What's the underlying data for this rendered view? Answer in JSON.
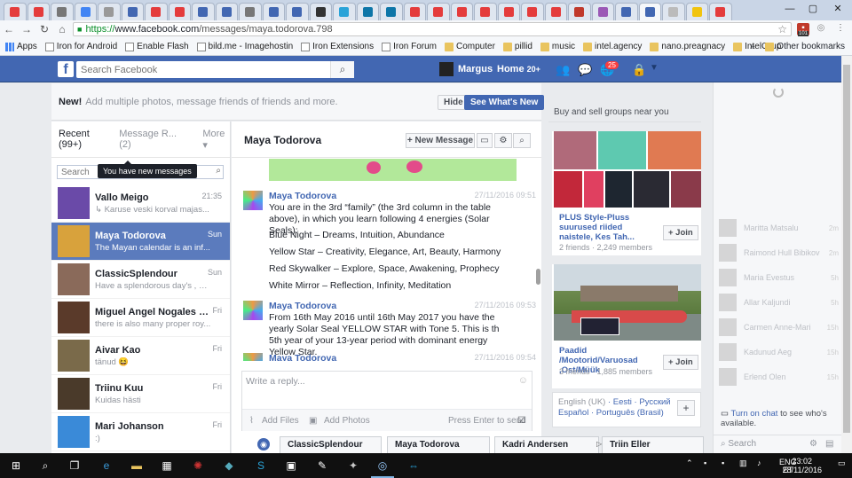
{
  "browser": {
    "url_scheme": "https://",
    "url_host": "www.facebook.com",
    "url_path": "/messages/maya.todorova.798",
    "bookmarks": [
      {
        "label": "Apps",
        "kind": "apps"
      },
      {
        "label": "Iron for Android",
        "kind": "page"
      },
      {
        "label": "Enable Flash",
        "kind": "page"
      },
      {
        "label": "bild.me - Imagehostin",
        "kind": "page"
      },
      {
        "label": "Iron Extensions",
        "kind": "page"
      },
      {
        "label": "Iron Forum",
        "kind": "page"
      },
      {
        "label": "Computer",
        "kind": "folder"
      },
      {
        "label": "pillid",
        "kind": "folder"
      },
      {
        "label": "music",
        "kind": "folder"
      },
      {
        "label": "intel.agency",
        "kind": "folder"
      },
      {
        "label": "nano.preagnacy",
        "kind": "folder"
      },
      {
        "label": "IntelGrup",
        "kind": "folder"
      }
    ],
    "bookmarks_overflow": "»",
    "other_bookmarks": "Other bookmarks",
    "ext_badge": "101",
    "tab_colors": [
      "#e43c3c",
      "#e43c3c",
      "#777",
      "#4285f4",
      "#999",
      "#4267b2",
      "#e43c3c",
      "#e43c3c",
      "#4267b2",
      "#4267b2",
      "#777",
      "#4267b2",
      "#4267b2",
      "#333",
      "#2aa3d8",
      "#0e76a8",
      "#0e76a8",
      "#e43c3c",
      "#e43c3c",
      "#e43c3c",
      "#e43c3c",
      "#e43c3c",
      "#e43c3c",
      "#e43c3c",
      "#c0392b",
      "#9b59b6",
      "#4267b2",
      "#4267b2",
      "#bbb",
      "#f1c40f",
      "#e43c3c"
    ]
  },
  "fb": {
    "search_placeholder": "Search Facebook",
    "user_name": "Margus",
    "home_label": "Home",
    "home_count": "20+",
    "notif_count": "25"
  },
  "notice": {
    "bold": "New!",
    "text": "Add multiple photos, message friends of friends and more.",
    "hide_label": "Hide",
    "whats_new_label": "See What's New"
  },
  "threads": {
    "recent_label": "Recent (99+)",
    "requests_label": "Message R...",
    "requests_count": "(2)",
    "more_label": "More ▾",
    "search_placeholder": "Search",
    "tooltip": "You have new messages",
    "items": [
      {
        "name": "Vallo Meigo",
        "snippet": "↳ Karuse veski korval majas...",
        "time": "21:35",
        "color": "#6a4aa8"
      },
      {
        "name": "Maya Todorova",
        "snippet": "The Mayan calendar is an inf...",
        "time": "Sun",
        "color": "#d8a23c",
        "selected": true
      },
      {
        "name": "ClassicSplendour",
        "snippet": "Have a splendorous day's , Ev...",
        "time": "Sun",
        "color": "#8a6a5a"
      },
      {
        "name": "Miguel Angel Nogales Lore...",
        "snippet": "there is also many proper roy...",
        "time": "Fri",
        "color": "#5a3a2a"
      },
      {
        "name": "Aivar Kao",
        "snippet": "tänud 😆",
        "time": "Fri",
        "color": "#7a6a4a"
      },
      {
        "name": "Triinu Kuu",
        "snippet": "Kuidas hästi",
        "time": "Fri",
        "color": "#4a3a2a"
      },
      {
        "name": "Mari Johanson",
        "snippet": ":)",
        "time": "Fri",
        "color": "#3a8ad8"
      }
    ]
  },
  "conversation": {
    "title": "Maya Todorova",
    "new_message_label": "+ New Message",
    "messages": [
      {
        "sender": "Maya Todorova",
        "time": "27/11/2016 09:51",
        "text": "You are in the 3rd “family” (the 3rd column in the table above), in which you learn following 4 energies (Solar Seals):",
        "lines": [
          "Blue Night – Dreams, Intuition, Abundance",
          "Yellow Star – Creativity, Elegance, Art, Beauty, Harmony",
          "Red Skywalker – Explore, Space, Awakening, Prophecy",
          "White Mirror – Reflection, Infinity, Meditation"
        ]
      },
      {
        "sender": "Maya Todorova",
        "time": "27/11/2016 09:53",
        "text": "From 16th May 2016 until 16th May 2017 you have the yearly Solar Seal YELLOW STAR with Tone 5. This is th 5th year of your 13-year period with dominant energy Yellow Star."
      },
      {
        "sender": "Maya Todorova",
        "time": "27/11/2016 09:54"
      }
    ],
    "reply_placeholder": "Write a reply...",
    "add_files": "Add Files",
    "add_photos": "Add Photos",
    "enter_to_send": "Press Enter to send"
  },
  "groups": {
    "header": "Buy and sell groups near you",
    "items": [
      {
        "name": "PLUS Style-Pluss suurused riided naistele, Kes Tah...",
        "meta": "2 friends · 2,249 members",
        "join": "+ Join"
      },
      {
        "name": "Paadid /Mootorid/Varuosad ,Ost/Müük",
        "meta": "3 friends · 1,885 members",
        "join": "+ Join"
      }
    ]
  },
  "languages": {
    "line1": [
      "English (UK)",
      "Eesti",
      "Русский"
    ],
    "line2": [
      "Español",
      "Português (Brasil)"
    ],
    "add": "+"
  },
  "chat": {
    "contacts": [
      {
        "name": "Maritta Matsalu",
        "time": "2m"
      },
      {
        "name": "Raimond Hull Bibikov",
        "time": "2m"
      },
      {
        "name": "Maria Evestus",
        "time": "5h"
      },
      {
        "name": "Allar Kaljundi",
        "time": "5h"
      },
      {
        "name": "Carmen Anne-Mari",
        "time": "15h"
      },
      {
        "name": "Kadunud Aeg",
        "time": "15h"
      },
      {
        "name": "Erlend Olen",
        "time": "15h"
      }
    ],
    "turn_on_link": "Turn on chat",
    "turn_on_rest": " to see who's available.",
    "search_placeholder": "Search"
  },
  "chat_tabs": [
    "ClassicSplendour",
    "Maya Todorova",
    "Kadri Andersen",
    "Triin Eller"
  ],
  "taskbar": {
    "lang_top": "ENG",
    "lang_bottom": "ET",
    "time": "23:02",
    "date": "28/11/2016"
  }
}
